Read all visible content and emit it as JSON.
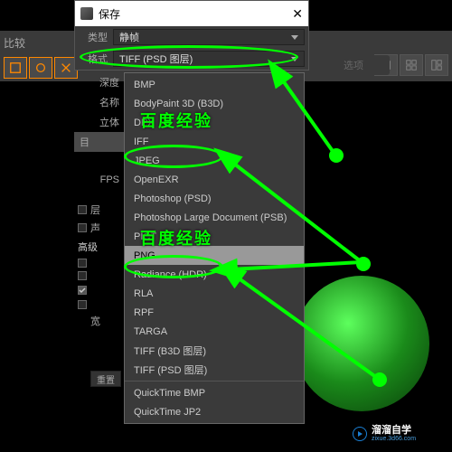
{
  "bg": {
    "compare": "比较"
  },
  "dialog": {
    "title": "保存",
    "type_label": "类型",
    "type_value": "静帧",
    "format_label": "格式",
    "format_value": "TIFF (PSD 图层)",
    "options_btn": "选项"
  },
  "side": {
    "depth": "深度",
    "name": "名称",
    "solid": "立体",
    "tab": "目",
    "fps": "FPS",
    "layer": "层",
    "sound": "声",
    "advanced": "高级",
    "width": "宽",
    "reset": "重置"
  },
  "formats": [
    "BMP",
    "BodyPaint 3D (B3D)",
    "DPX",
    "IFF",
    "JPEG",
    "OpenEXR",
    "Photoshop (PSD)",
    "Photoshop Large Document (PSB)",
    "PICT",
    "PNG",
    "Radiance (HDR)",
    "RLA",
    "RPF",
    "TARGA",
    "TIFF (B3D 图层)",
    "TIFF (PSD 图层)",
    "QuickTime BMP",
    "QuickTime JP2"
  ],
  "selected_format": "PNG",
  "watermark": "百度经验",
  "logo": {
    "cn": "溜溜自学",
    "url": "zixue.3d66.com"
  }
}
